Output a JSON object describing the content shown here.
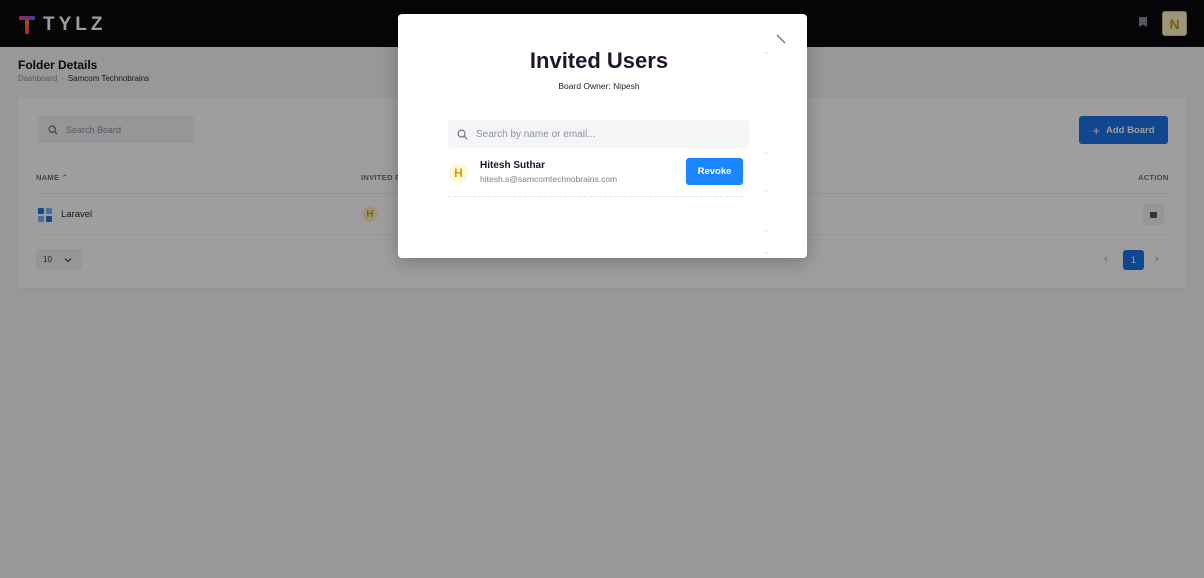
{
  "app": {
    "logo_text": "TYLZ",
    "user_initial": "N"
  },
  "page": {
    "title": "Folder Details",
    "breadcrumb": {
      "root": "Dashboard",
      "separator": "-",
      "current": "Samcom Technobrains"
    }
  },
  "toolbar": {
    "search_placeholder": "Search Board",
    "add_label": "Add Board"
  },
  "table": {
    "headers": {
      "name": "NAME",
      "invited": "INVITED P",
      "action": "ACTION"
    },
    "rows": [
      {
        "name": "Laravel",
        "invited_initial": "H"
      }
    ]
  },
  "pagination": {
    "page_size": "10",
    "current_page": "1"
  },
  "modal": {
    "title": "Invited Users",
    "subtitle": "Board Owner: Nipesh",
    "search_placeholder": "Search by name or email...",
    "users": [
      {
        "initial": "H",
        "name": "Hitesh Suthar",
        "email": "hitesh.s@samcomtechnobrains.com",
        "action_label": "Revoke"
      }
    ]
  },
  "colors": {
    "primary": "#1a73e8",
    "revoke": "#1a86ff",
    "topbar": "#0b0b10",
    "avatar_bg": "#fff3c8"
  }
}
